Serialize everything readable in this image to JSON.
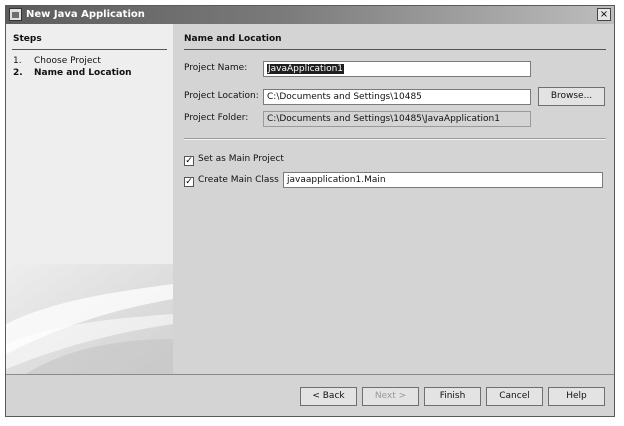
{
  "window": {
    "title": "New Java Application",
    "close_glyph": "×"
  },
  "steps": {
    "heading": "Steps",
    "items": [
      {
        "number": "1.",
        "label": "Choose Project",
        "current": false
      },
      {
        "number": "2.",
        "label": "Name and Location",
        "current": true
      }
    ]
  },
  "panel": {
    "title": "Name and Location",
    "project_name": {
      "label": "Project Name:",
      "value": "JavaApplication1"
    },
    "project_location": {
      "label": "Project Location:",
      "value": "C:\\Documents and Settings\\10485"
    },
    "browse_label": "Browse...",
    "project_folder": {
      "label": "Project Folder:",
      "value": "C:\\Documents and Settings\\10485\\JavaApplication1"
    },
    "set_main_project": {
      "label": "Set as Main Project",
      "checked": true
    },
    "create_main_class": {
      "label": "Create Main Class",
      "checked": true,
      "value": "javaapplication1.Main"
    }
  },
  "buttons": {
    "back": "< Back",
    "next": "Next >",
    "finish": "Finish",
    "cancel": "Cancel",
    "help": "Help"
  },
  "icons": {
    "window_icon": "java-app-icon",
    "close_icon": "close-icon"
  }
}
